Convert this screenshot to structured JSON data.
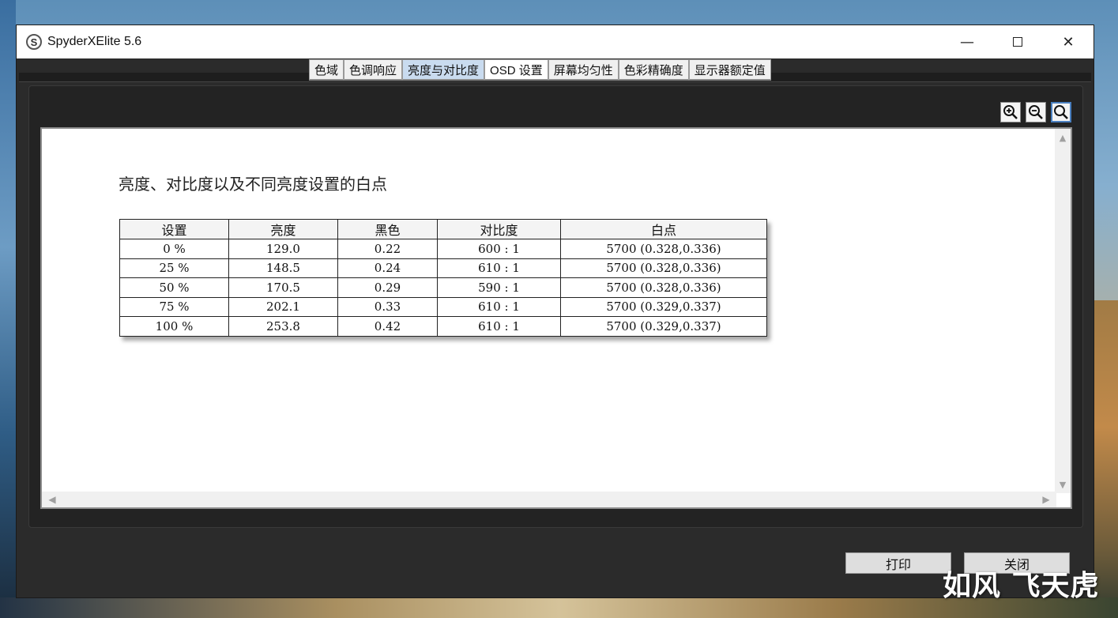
{
  "window": {
    "title": "SpyderXElite 5.6",
    "logo_letter": "S",
    "controls": {
      "minimize": "—",
      "close": "✕"
    }
  },
  "tabs": [
    {
      "label": "色域",
      "active": false
    },
    {
      "label": "色调响应",
      "active": false
    },
    {
      "label": "亮度与对比度",
      "active": true
    },
    {
      "label": "OSD 设置",
      "active": false
    },
    {
      "label": "屏幕均匀性",
      "active": false
    },
    {
      "label": "色彩精确度",
      "active": false
    },
    {
      "label": "显示器额定值",
      "active": false
    }
  ],
  "zoom": {
    "zoom_in_icon": "zoom-in-icon",
    "zoom_out_icon": "zoom-out-icon",
    "zoom_fit_icon": "zoom-fit-icon"
  },
  "report": {
    "title": "亮度、对比度以及不同亮度设置的白点",
    "columns": [
      "设置",
      "亮度",
      "黑色",
      "对比度",
      "白点"
    ],
    "rows": [
      [
        "0 %",
        "129.0",
        "0.22",
        "600 : 1",
        "5700 (0.328,0.336)"
      ],
      [
        "25 %",
        "148.5",
        "0.24",
        "610 : 1",
        "5700 (0.328,0.336)"
      ],
      [
        "50 %",
        "170.5",
        "0.29",
        "590 : 1",
        "5700 (0.328,0.336)"
      ],
      [
        "75 %",
        "202.1",
        "0.33",
        "610 : 1",
        "5700 (0.329,0.337)"
      ],
      [
        "100 %",
        "253.8",
        "0.42",
        "610 : 1",
        "5700 (0.329,0.337)"
      ]
    ]
  },
  "footer": {
    "print_label": "打印",
    "close_label": "关闭"
  },
  "watermark": "如风 飞天虎",
  "colors": {
    "active_tab": "#c9dbef",
    "window_bg": "#2b2b2b",
    "content_bg": "#ffffff"
  }
}
